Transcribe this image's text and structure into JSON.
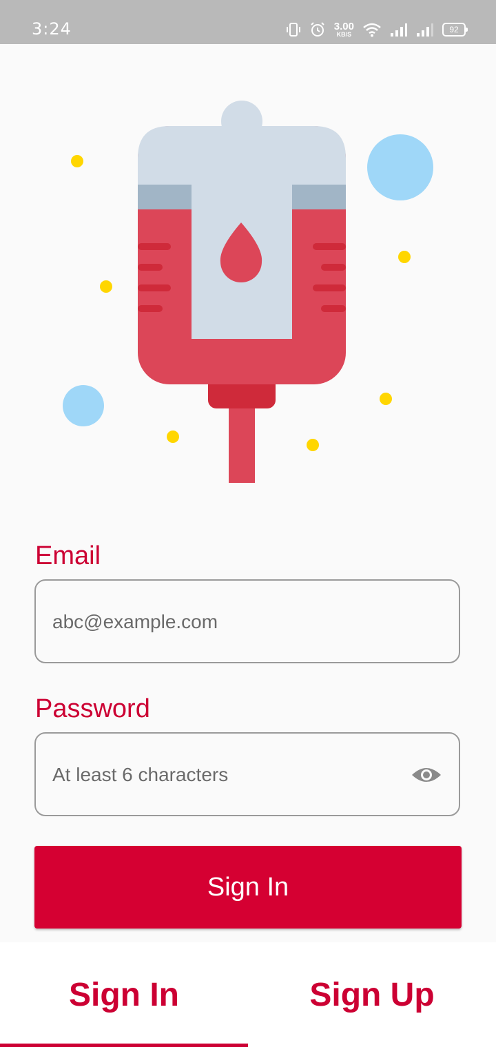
{
  "status_bar": {
    "time": "3:24",
    "net_speed_value": "3.00",
    "net_speed_unit": "KB/S",
    "battery": "92"
  },
  "form": {
    "email_label": "Email",
    "email_placeholder": "abc@example.com",
    "password_label": "Password",
    "password_placeholder": "At least 6 characters",
    "submit_label": "Sign In"
  },
  "tabs": {
    "sign_in": "Sign In",
    "sign_up": "Sign Up",
    "active": "sign_in"
  },
  "colors": {
    "accent": "#cc0033",
    "button": "#d50032",
    "blood": "#dc4658",
    "bag_top": "#d1dce7"
  },
  "icons": [
    "vibrate-icon",
    "alarm-icon",
    "wifi-icon",
    "signal-icon",
    "battery-icon",
    "eye-icon",
    "blood-bag-illustration"
  ]
}
